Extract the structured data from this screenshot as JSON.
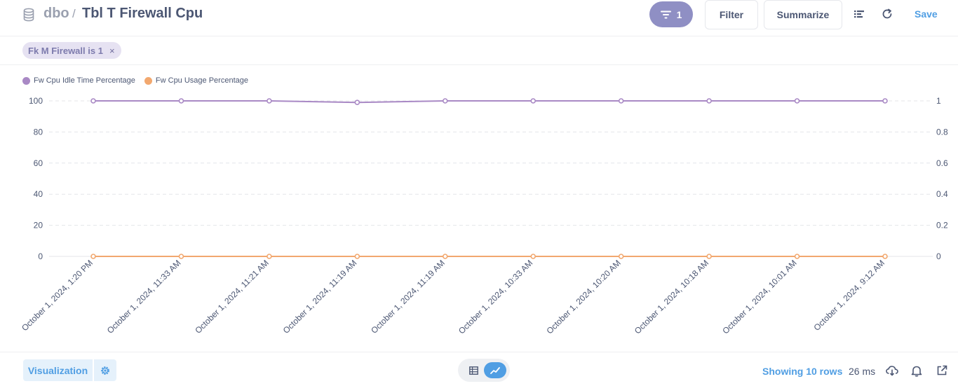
{
  "header": {
    "database": "dbo",
    "separator": "/",
    "title": "Tbl T Firewall Cpu",
    "filter_count": "1",
    "filter_label": "Filter",
    "summarize_label": "Summarize",
    "save_label": "Save"
  },
  "filters": [
    {
      "label": "Fk M Firewall is 1",
      "close": "×"
    }
  ],
  "footer": {
    "visualization_label": "Visualization",
    "row_count": "Showing 10 rows",
    "timing": "26 ms"
  },
  "colors": {
    "accent": "#509ee3",
    "filter_pill_bg": "#e6e2f2",
    "series_idle": "#a989c5",
    "series_usage": "#f2a86f"
  },
  "chart_data": {
    "type": "line",
    "categories": [
      "October 1, 2024, 1:20 PM",
      "October 1, 2024, 11:33 AM",
      "October 1, 2024, 11:21 AM",
      "October 1, 2024, 11:19 AM",
      "October 1, 2024, 11:19 AM",
      "October 1, 2024, 10:33 AM",
      "October 1, 2024, 10:20 AM",
      "October 1, 2024, 10:18 AM",
      "October 1, 2024, 10:01 AM",
      "October 1, 2024, 9:12 AM"
    ],
    "series": [
      {
        "name": "Fw Cpu Idle Time Percentage",
        "axis": "left",
        "color": "#a989c5",
        "values": [
          100,
          100,
          100,
          99,
          100,
          100,
          100,
          100,
          100,
          100
        ]
      },
      {
        "name": "Fw Cpu Usage Percentage",
        "axis": "right",
        "color": "#f2a86f",
        "values": [
          0,
          0,
          0,
          0,
          0,
          0,
          0,
          0,
          0,
          0
        ]
      }
    ],
    "y_left": {
      "ticks": [
        "0",
        "20",
        "40",
        "60",
        "80",
        "100"
      ],
      "range": [
        0,
        100
      ]
    },
    "y_right": {
      "ticks": [
        "0",
        "0.2",
        "0.4",
        "0.6",
        "0.8",
        "1"
      ],
      "range": [
        0,
        1
      ]
    },
    "grid": true,
    "legend": "top-left"
  }
}
